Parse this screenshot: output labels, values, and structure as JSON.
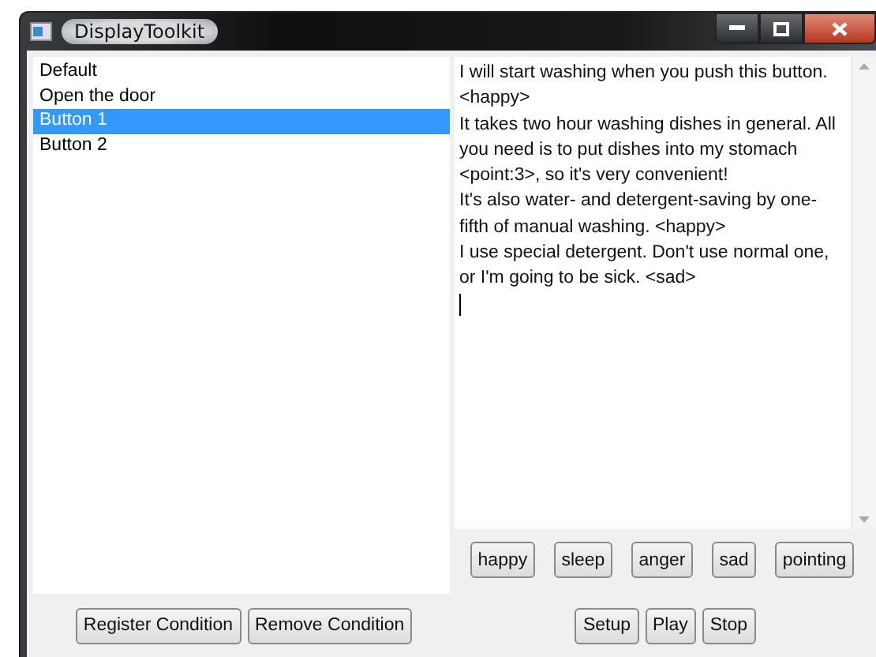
{
  "window": {
    "title": "DisplayToolkit"
  },
  "conditions": [
    {
      "label": "Default",
      "selected": false
    },
    {
      "label": "Open the door",
      "selected": false
    },
    {
      "label": "Button 1",
      "selected": true
    },
    {
      "label": "Button 2",
      "selected": false
    }
  ],
  "editor": {
    "lines": [
      "I will start washing when you push this button.",
      "<happy>",
      "It takes two hour washing dishes in general. All",
      "you need is to put dishes into my stomach",
      "<point:3>, so it's very convenient!",
      "It's also water- and detergent-saving by one-",
      "fifth of manual washing. <happy>",
      "I use special detergent. Don't use normal one,",
      "or I'm going to be sick. <sad>"
    ]
  },
  "emotion_buttons": [
    "happy",
    "sleep",
    "anger",
    "sad",
    "pointing"
  ],
  "condition_buttons": [
    "Register Condition",
    "Remove Condition"
  ],
  "playback_buttons": [
    "Setup",
    "Play",
    "Stop"
  ]
}
